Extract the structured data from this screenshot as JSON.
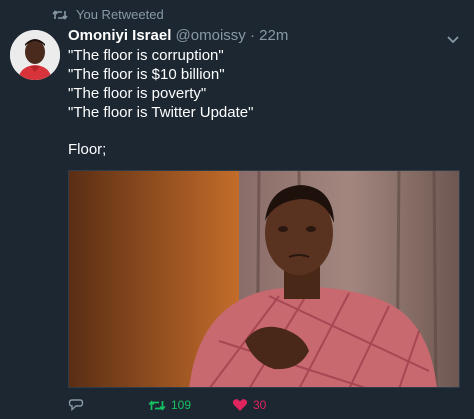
{
  "retweet_banner": {
    "icon": "retweet-icon",
    "label": "You Retweeted",
    "color": "#8899a6"
  },
  "tweet": {
    "author_name": "Omoniyi Israel",
    "author_handle": "@omoissy",
    "separator": "·",
    "timestamp": "22m",
    "lines": [
      "\"The floor is corruption\"",
      "\"The floor is $10 billion\"",
      "\"The floor is poverty\"",
      "\"The floor is Twitter Update\"",
      "Floor;"
    ],
    "media": {
      "description_icon": "man-reaction-photo"
    },
    "actions": {
      "reply_icon": "reply-icon",
      "retweet_icon": "retweet-icon",
      "retweet_count": "109",
      "retweet_color": "#17bf63",
      "like_icon": "heart-icon",
      "like_count": "30",
      "like_color": "#e0245e"
    }
  },
  "colors": {
    "background": "#1c2732",
    "secondary_text": "#8899a6"
  }
}
